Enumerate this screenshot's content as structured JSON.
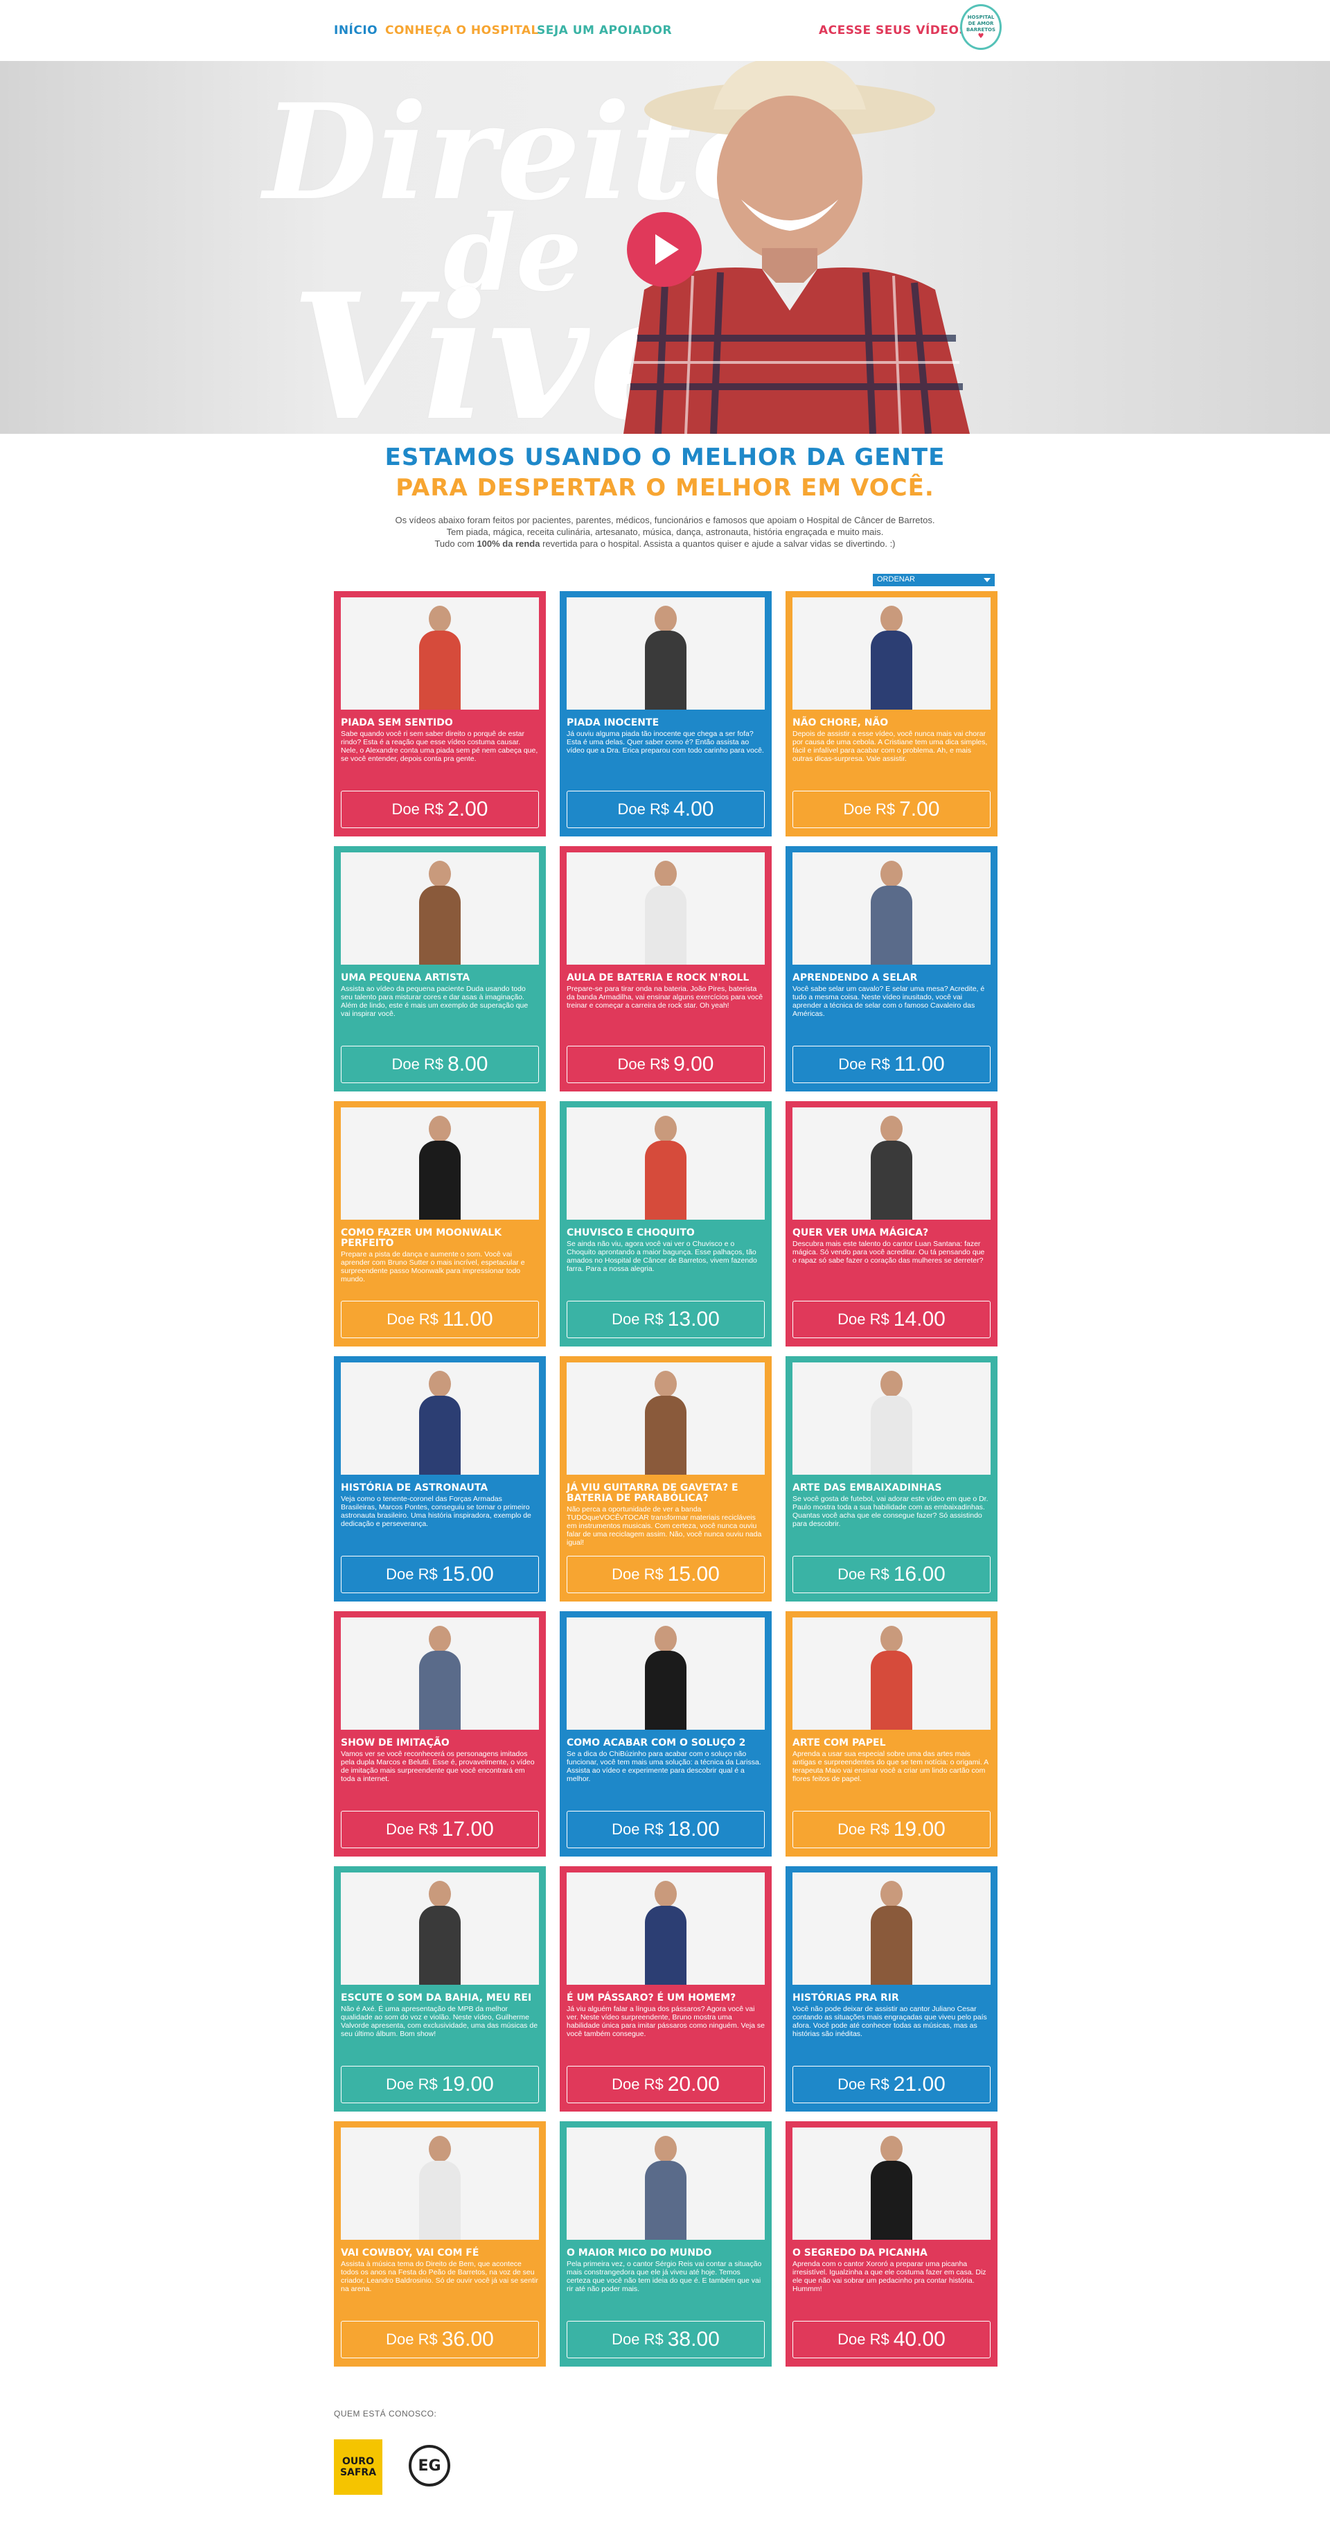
{
  "nav": {
    "inicio": "INÍCIO",
    "hospital": "CONHEÇA O HOSPITAL",
    "apoiador": "SEJA UM APOIADOR",
    "videos": "ACESSE SEUS VÍDEOS",
    "logo_line1": "HOSPITAL",
    "logo_line2": "DE AMOR",
    "logo_line3": "BARRETOS"
  },
  "hero": {
    "title_1": "Direito",
    "title_2": "de",
    "title_3": "Viver",
    "play_icon": "play-icon"
  },
  "headline": {
    "line1": "ESTAMOS USANDO O MELHOR DA GENTE",
    "line2": "PARA DESPERTAR O MELHOR EM VOCÊ."
  },
  "intro": {
    "p1": "Os vídeos abaixo foram feitos por pacientes, parentes, médicos, funcionários e famosos que apoiam o Hospital de Câncer de Barretos.",
    "p2": "Tem piada, mágica, receita culinária, artesanato, música, dança, astronauta, história engraçada e muito mais.",
    "p3_a": "Tudo com ",
    "p3_b": "100% da renda",
    "p3_c": " revertida para o hospital. Assista a quantos quiser e ajude a salvar vidas se divertindo. :)"
  },
  "ordenar": {
    "label": "ORDENAR"
  },
  "donate_prefix": "Doe R$",
  "colors": {
    "red": "#e0395a",
    "blue": "#1e88c9",
    "orange": "#f7a531",
    "teal": "#3ab3a5"
  },
  "cards": [
    {
      "title": "PIADA SEM SENTIDO",
      "desc": "Sabe quando você ri sem saber direito o porquê de estar rindo? Esta é a reação que esse vídeo costuma causar. Nele, o Alexandre conta uma piada sem pé nem cabeça que, se você entender, depois conta pra gente.",
      "amount": "2.00",
      "color": "red"
    },
    {
      "title": "PIADA INOCENTE",
      "desc": "Já ouviu alguma piada tão inocente que chega a ser fofa? Esta é uma delas. Quer saber como é? Então assista ao vídeo que a Dra. Erica preparou com todo carinho para você.",
      "amount": "4.00",
      "color": "blue"
    },
    {
      "title": "NÃO CHORE, NÃO",
      "desc": "Depois de assistir a esse vídeo, você nunca mais vai chorar por causa de uma cebola. A Cristiane tem uma dica simples, fácil e infalível para acabar com o problema. Ah, e mais outras dicas-surpresa. Vale assistir.",
      "amount": "7.00",
      "color": "orange"
    },
    {
      "title": "UMA PEQUENA ARTISTA",
      "desc": "Assista ao vídeo da pequena paciente Duda usando todo seu talento para misturar cores e dar asas à imaginação. Além de lindo, este é mais um exemplo de superação que vai inspirar você.",
      "amount": "8.00",
      "color": "teal"
    },
    {
      "title": "AULA DE BATERIA E ROCK N'ROLL",
      "desc": "Prepare-se para tirar onda na bateria. João Pires, baterista da banda Armadilha, vai ensinar alguns exercícios para você treinar e começar a carreira de rock star. Oh yeah!",
      "amount": "9.00",
      "color": "red"
    },
    {
      "title": "APRENDENDO A SELAR",
      "desc": "Você sabe selar um cavalo? E selar uma mesa? Acredite, é tudo a mesma coisa. Neste vídeo inusitado, você vai aprender a técnica de selar com o famoso Cavaleiro das Américas.",
      "amount": "11.00",
      "color": "blue"
    },
    {
      "title": "COMO FAZER UM MOONWALK PERFEITO",
      "desc": "Prepare a pista de dança e aumente o som. Você vai aprender com Bruno Sutter o mais incrível, espetacular e surpreendente passo Moonwalk para impressionar todo mundo.",
      "amount": "11.00",
      "color": "orange"
    },
    {
      "title": "CHUVISCO E CHOQUITO",
      "desc": "Se ainda não viu, agora você vai ver o Chuvisco e o Choquito aprontando a maior bagunça. Esse palhaços, tão amados no Hospital de Câncer de Barretos, vivem fazendo farra. Para a nossa alegria.",
      "amount": "13.00",
      "color": "teal"
    },
    {
      "title": "QUER VER UMA MÁGICA?",
      "desc": "Descubra mais este talento do cantor Luan Santana: fazer mágica. Só vendo para você acreditar. Ou tá pensando que o rapaz só sabe fazer o coração das mulheres se derreter?",
      "amount": "14.00",
      "color": "red"
    },
    {
      "title": "HISTÓRIA DE ASTRONAUTA",
      "desc": "Veja como o tenente-coronel das Forças Armadas Brasileiras, Marcos Pontes, conseguiu se tornar o primeiro astronauta brasileiro. Uma história inspiradora, exemplo de dedicação e perseverança.",
      "amount": "15.00",
      "color": "blue"
    },
    {
      "title": "JÁ VIU GUITARRA DE GAVETA? E BATERIA DE PARABÓLICA?",
      "desc": "Não perca a oportunidade de ver a banda TUDOqueVOCÊvTOCAR transformar materiais recicláveis em instrumentos musicais. Com certeza, você nunca ouviu falar de uma reciclagem assim. Não, você nunca ouviu nada igual!",
      "amount": "15.00",
      "color": "orange"
    },
    {
      "title": "ARTE DAS EMBAIXADINHAS",
      "desc": "Se você gosta de futebol, vai adorar este vídeo em que o Dr. Paulo mostra toda a sua habilidade com as embaixadinhas. Quantas você acha que ele consegue fazer? Só assistindo para descobrir.",
      "amount": "16.00",
      "color": "teal"
    },
    {
      "title": "SHOW DE IMITAÇÃO",
      "desc": "Vamos ver se você reconhecerá os personagens imitados pela dupla Marcos e Belutti. Esse é, provavelmente, o vídeo de imitação mais surpreendente que você encontrará em toda a internet.",
      "amount": "17.00",
      "color": "red"
    },
    {
      "title": "COMO ACABAR COM O SOLUÇO 2",
      "desc": "Se a dica do ChiBúzinho para acabar com o soluço não funcionar, você tem mais uma solução: a técnica da Larissa. Assista ao vídeo e experimente para descobrir qual é a melhor.",
      "amount": "18.00",
      "color": "blue"
    },
    {
      "title": "ARTE COM PAPEL",
      "desc": "Aprenda a usar sua especial sobre uma das artes mais antigas e surpreendentes do que se tem notícia: o origami. A terapeuta Maio vai ensinar você a criar um lindo cartão com flores feitos de papel.",
      "amount": "19.00",
      "color": "orange"
    },
    {
      "title": "ESCUTE O SOM DA BAHIA, MEU REI",
      "desc": "Não é Axé. É uma apresentação de MPB da melhor qualidade ao som do voz e violão. Neste vídeo, Guilherme Valvorde apresenta, com exclusividade, uma das músicas de seu último álbum. Bom show!",
      "amount": "19.00",
      "color": "teal"
    },
    {
      "title": "É UM PÁSSARO? É UM HOMEM?",
      "desc": "Já viu alguém falar a língua dos pássaros? Agora você vai ver. Neste vídeo surpreendente, Bruno mostra uma habilidade única para imitar pássaros como ninguém. Veja se você também consegue.",
      "amount": "20.00",
      "color": "red"
    },
    {
      "title": "HISTÓRIAS PRA RIR",
      "desc": "Você não pode deixar de assistir ao cantor Juliano Cesar contando as situações mais engraçadas que viveu pelo país afora. Você pode até conhecer todas as músicas, mas as histórias são inéditas.",
      "amount": "21.00",
      "color": "blue"
    },
    {
      "title": "VAI COWBOY, VAI COM FÉ",
      "desc": "Assista à música tema do Direito de Bem, que acontece todos os anos na Festa do Peão de Barretos, na voz de seu criador, Leandro Baldrosinio. Só de ouvir você já vai se sentir na arena.",
      "amount": "36.00",
      "color": "orange"
    },
    {
      "title": "O MAIOR MICO DO MUNDO",
      "desc": "Pela primeira vez, o cantor Sérgio Reis vai contar a situação mais constrangedora que ele já viveu até hoje. Temos certeza que você não tem ideia do que é. E também que vai rir até não poder mais.",
      "amount": "38.00",
      "color": "teal"
    },
    {
      "title": "O SEGREDO DA PICANHA",
      "desc": "Aprenda com o cantor Xororó a preparar uma picanha irresistível. Igualzinha a que ele costuma fazer em casa. Diz ele que não vai sobrar um pedacinho pra contar história. Hummm!",
      "amount": "40.00",
      "color": "red"
    }
  ],
  "footer": {
    "quem": "QUEM ESTÁ CONOSCO:",
    "sponsor1_a": "OURO",
    "sponsor1_b": "SAFRA",
    "sponsor2": "EG"
  }
}
